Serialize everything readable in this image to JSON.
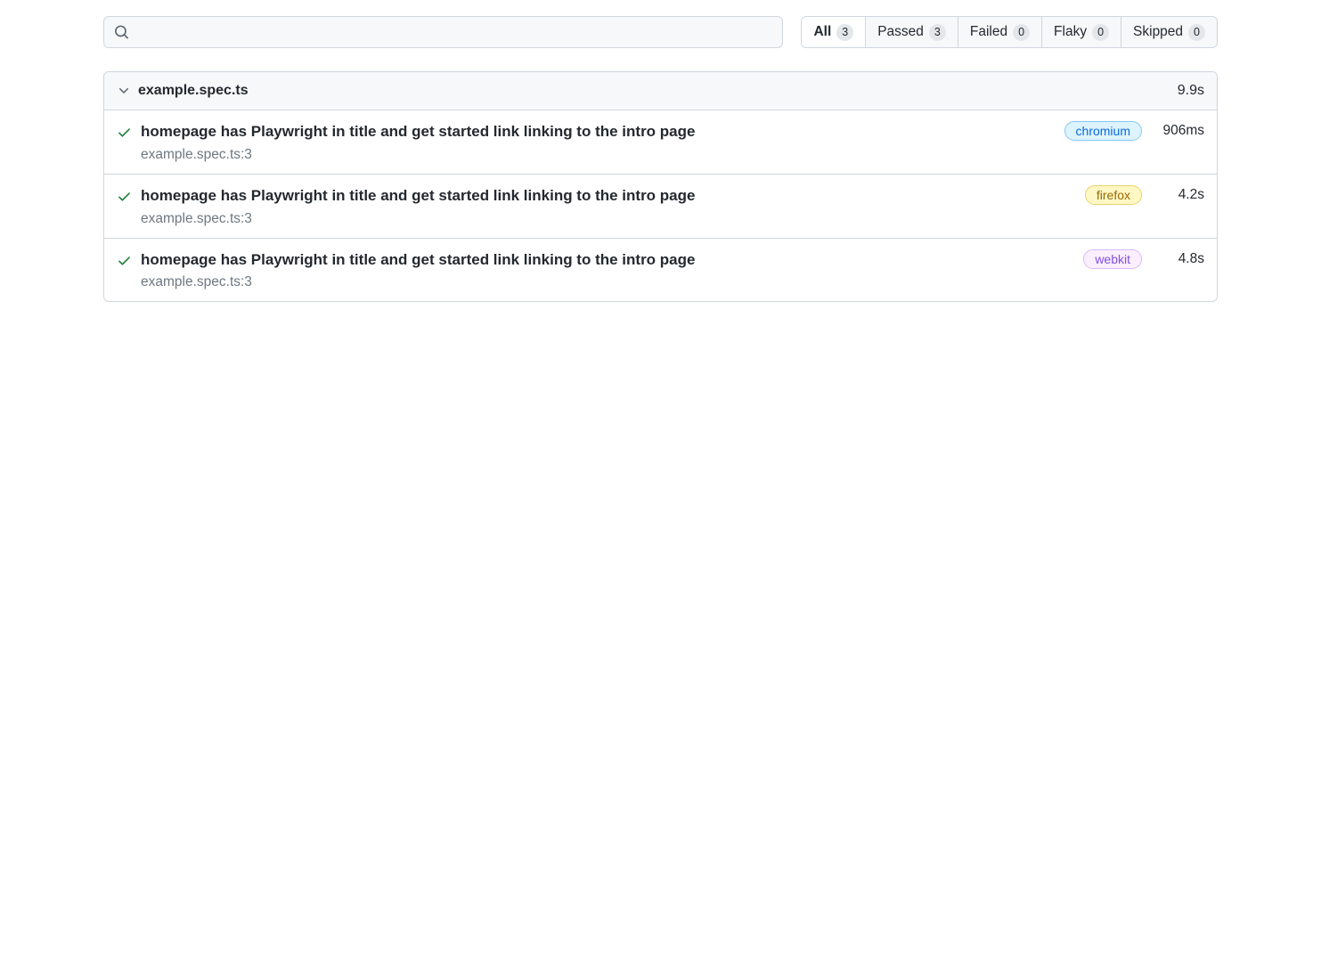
{
  "search": {
    "placeholder": ""
  },
  "filters": [
    {
      "label": "All",
      "count": "3",
      "active": true
    },
    {
      "label": "Passed",
      "count": "3",
      "active": false
    },
    {
      "label": "Failed",
      "count": "0",
      "active": false
    },
    {
      "label": "Flaky",
      "count": "0",
      "active": false
    },
    {
      "label": "Skipped",
      "count": "0",
      "active": false
    }
  ],
  "spec": {
    "name": "example.spec.ts",
    "duration": "9.9s",
    "tests": [
      {
        "title": "homepage has Playwright in title and get started link linking to the intro page",
        "location": "example.spec.ts:3",
        "browser": "chromium",
        "duration": "906ms"
      },
      {
        "title": "homepage has Playwright in title and get started link linking to the intro page",
        "location": "example.spec.ts:3",
        "browser": "firefox",
        "duration": "4.2s"
      },
      {
        "title": "homepage has Playwright in title and get started link linking to the intro page",
        "location": "example.spec.ts:3",
        "browser": "webkit",
        "duration": "4.8s"
      }
    ]
  }
}
